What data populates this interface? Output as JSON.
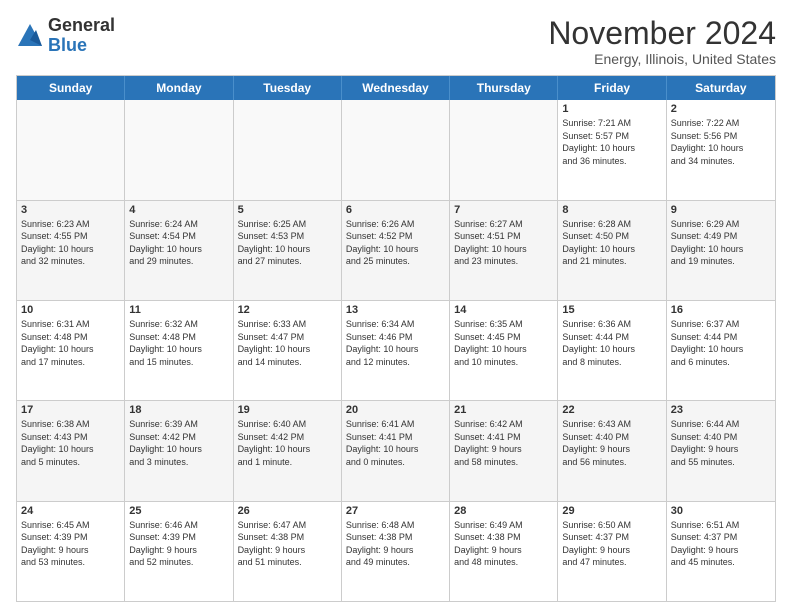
{
  "logo": {
    "line1": "General",
    "line2": "Blue"
  },
  "title": "November 2024",
  "subtitle": "Energy, Illinois, United States",
  "weekdays": [
    "Sunday",
    "Monday",
    "Tuesday",
    "Wednesday",
    "Thursday",
    "Friday",
    "Saturday"
  ],
  "rows": [
    [
      {
        "day": "",
        "info": ""
      },
      {
        "day": "",
        "info": ""
      },
      {
        "day": "",
        "info": ""
      },
      {
        "day": "",
        "info": ""
      },
      {
        "day": "",
        "info": ""
      },
      {
        "day": "1",
        "info": "Sunrise: 7:21 AM\nSunset: 5:57 PM\nDaylight: 10 hours\nand 36 minutes."
      },
      {
        "day": "2",
        "info": "Sunrise: 7:22 AM\nSunset: 5:56 PM\nDaylight: 10 hours\nand 34 minutes."
      }
    ],
    [
      {
        "day": "3",
        "info": "Sunrise: 6:23 AM\nSunset: 4:55 PM\nDaylight: 10 hours\nand 32 minutes."
      },
      {
        "day": "4",
        "info": "Sunrise: 6:24 AM\nSunset: 4:54 PM\nDaylight: 10 hours\nand 29 minutes."
      },
      {
        "day": "5",
        "info": "Sunrise: 6:25 AM\nSunset: 4:53 PM\nDaylight: 10 hours\nand 27 minutes."
      },
      {
        "day": "6",
        "info": "Sunrise: 6:26 AM\nSunset: 4:52 PM\nDaylight: 10 hours\nand 25 minutes."
      },
      {
        "day": "7",
        "info": "Sunrise: 6:27 AM\nSunset: 4:51 PM\nDaylight: 10 hours\nand 23 minutes."
      },
      {
        "day": "8",
        "info": "Sunrise: 6:28 AM\nSunset: 4:50 PM\nDaylight: 10 hours\nand 21 minutes."
      },
      {
        "day": "9",
        "info": "Sunrise: 6:29 AM\nSunset: 4:49 PM\nDaylight: 10 hours\nand 19 minutes."
      }
    ],
    [
      {
        "day": "10",
        "info": "Sunrise: 6:31 AM\nSunset: 4:48 PM\nDaylight: 10 hours\nand 17 minutes."
      },
      {
        "day": "11",
        "info": "Sunrise: 6:32 AM\nSunset: 4:48 PM\nDaylight: 10 hours\nand 15 minutes."
      },
      {
        "day": "12",
        "info": "Sunrise: 6:33 AM\nSunset: 4:47 PM\nDaylight: 10 hours\nand 14 minutes."
      },
      {
        "day": "13",
        "info": "Sunrise: 6:34 AM\nSunset: 4:46 PM\nDaylight: 10 hours\nand 12 minutes."
      },
      {
        "day": "14",
        "info": "Sunrise: 6:35 AM\nSunset: 4:45 PM\nDaylight: 10 hours\nand 10 minutes."
      },
      {
        "day": "15",
        "info": "Sunrise: 6:36 AM\nSunset: 4:44 PM\nDaylight: 10 hours\nand 8 minutes."
      },
      {
        "day": "16",
        "info": "Sunrise: 6:37 AM\nSunset: 4:44 PM\nDaylight: 10 hours\nand 6 minutes."
      }
    ],
    [
      {
        "day": "17",
        "info": "Sunrise: 6:38 AM\nSunset: 4:43 PM\nDaylight: 10 hours\nand 5 minutes."
      },
      {
        "day": "18",
        "info": "Sunrise: 6:39 AM\nSunset: 4:42 PM\nDaylight: 10 hours\nand 3 minutes."
      },
      {
        "day": "19",
        "info": "Sunrise: 6:40 AM\nSunset: 4:42 PM\nDaylight: 10 hours\nand 1 minute."
      },
      {
        "day": "20",
        "info": "Sunrise: 6:41 AM\nSunset: 4:41 PM\nDaylight: 10 hours\nand 0 minutes."
      },
      {
        "day": "21",
        "info": "Sunrise: 6:42 AM\nSunset: 4:41 PM\nDaylight: 9 hours\nand 58 minutes."
      },
      {
        "day": "22",
        "info": "Sunrise: 6:43 AM\nSunset: 4:40 PM\nDaylight: 9 hours\nand 56 minutes."
      },
      {
        "day": "23",
        "info": "Sunrise: 6:44 AM\nSunset: 4:40 PM\nDaylight: 9 hours\nand 55 minutes."
      }
    ],
    [
      {
        "day": "24",
        "info": "Sunrise: 6:45 AM\nSunset: 4:39 PM\nDaylight: 9 hours\nand 53 minutes."
      },
      {
        "day": "25",
        "info": "Sunrise: 6:46 AM\nSunset: 4:39 PM\nDaylight: 9 hours\nand 52 minutes."
      },
      {
        "day": "26",
        "info": "Sunrise: 6:47 AM\nSunset: 4:38 PM\nDaylight: 9 hours\nand 51 minutes."
      },
      {
        "day": "27",
        "info": "Sunrise: 6:48 AM\nSunset: 4:38 PM\nDaylight: 9 hours\nand 49 minutes."
      },
      {
        "day": "28",
        "info": "Sunrise: 6:49 AM\nSunset: 4:38 PM\nDaylight: 9 hours\nand 48 minutes."
      },
      {
        "day": "29",
        "info": "Sunrise: 6:50 AM\nSunset: 4:37 PM\nDaylight: 9 hours\nand 47 minutes."
      },
      {
        "day": "30",
        "info": "Sunrise: 6:51 AM\nSunset: 4:37 PM\nDaylight: 9 hours\nand 45 minutes."
      }
    ]
  ]
}
